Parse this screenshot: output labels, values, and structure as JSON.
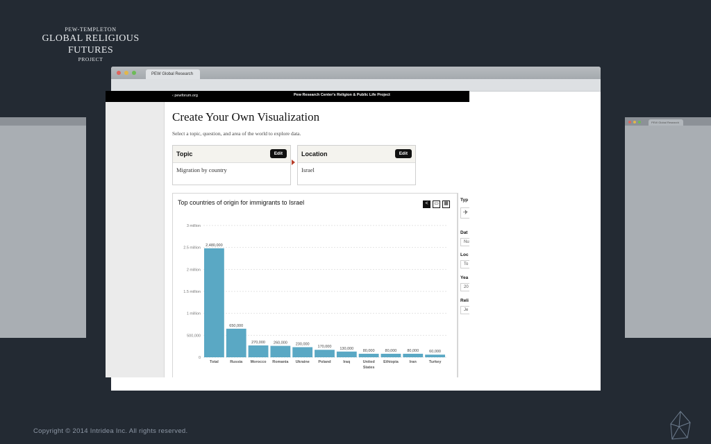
{
  "brand": {
    "line1": "PEW-TEMPLETON",
    "line2": "GLOBAL RELIGIOUS FUTURES",
    "line3": "PROJECT"
  },
  "browser": {
    "tab_label": "PEW Global Research",
    "side_tab_label": "PEW Global Research"
  },
  "site": {
    "header_left": "‹ pewforum.org",
    "header_center": "Pew Research Center's Religion & Public Life Project",
    "title": "Create Your Own Visualization",
    "subtitle": "Select a topic, question, and area of the world to explore data.",
    "topic": {
      "label": "Topic",
      "edit": "Edit",
      "value": "Migration by country"
    },
    "location": {
      "label": "Location",
      "edit": "Edit",
      "value": "Israel"
    },
    "right_panel": {
      "type_label": "Typ",
      "data_label": "Dat",
      "data_value": "Nu",
      "location_label": "Loc",
      "location_value": "To",
      "year_label": "Yea",
      "year_value": "20",
      "religion_label": "Reli",
      "religion_value": "Je"
    }
  },
  "chart_data": {
    "type": "bar",
    "title": "Top countries of origin for immigrants to Israel",
    "categories": [
      "Total",
      "Russia",
      "Morocco",
      "Romania",
      "Ukraine",
      "Poland",
      "Iraq",
      "United States",
      "Ethiopia",
      "Iran",
      "Turkey"
    ],
    "values": [
      2480000,
      650000,
      270000,
      260000,
      230000,
      170000,
      130000,
      80000,
      80000,
      80000,
      60000
    ],
    "value_labels": [
      "2,480,000",
      "650,000",
      "270,000",
      "260,000",
      "230,000",
      "170,000",
      "130,000",
      "80,000",
      "80,000",
      "80,000",
      "60,000"
    ],
    "y_ticks": [
      0,
      500000,
      1000000,
      1500000,
      2000000,
      2500000,
      3000000
    ],
    "y_tick_labels": [
      "0",
      "500,000",
      "1 million",
      "1.5 million",
      "2 million",
      "2.5 million",
      "3 million"
    ],
    "ylim": [
      0,
      3000000
    ],
    "grid": true,
    "bar_color": "#5aa8c4"
  },
  "footer": {
    "copyright": "Copyright © 2014 Intridea Inc. All rights reserved."
  },
  "colors": {
    "background": "#232a33",
    "accent_red": "#b8402c"
  }
}
